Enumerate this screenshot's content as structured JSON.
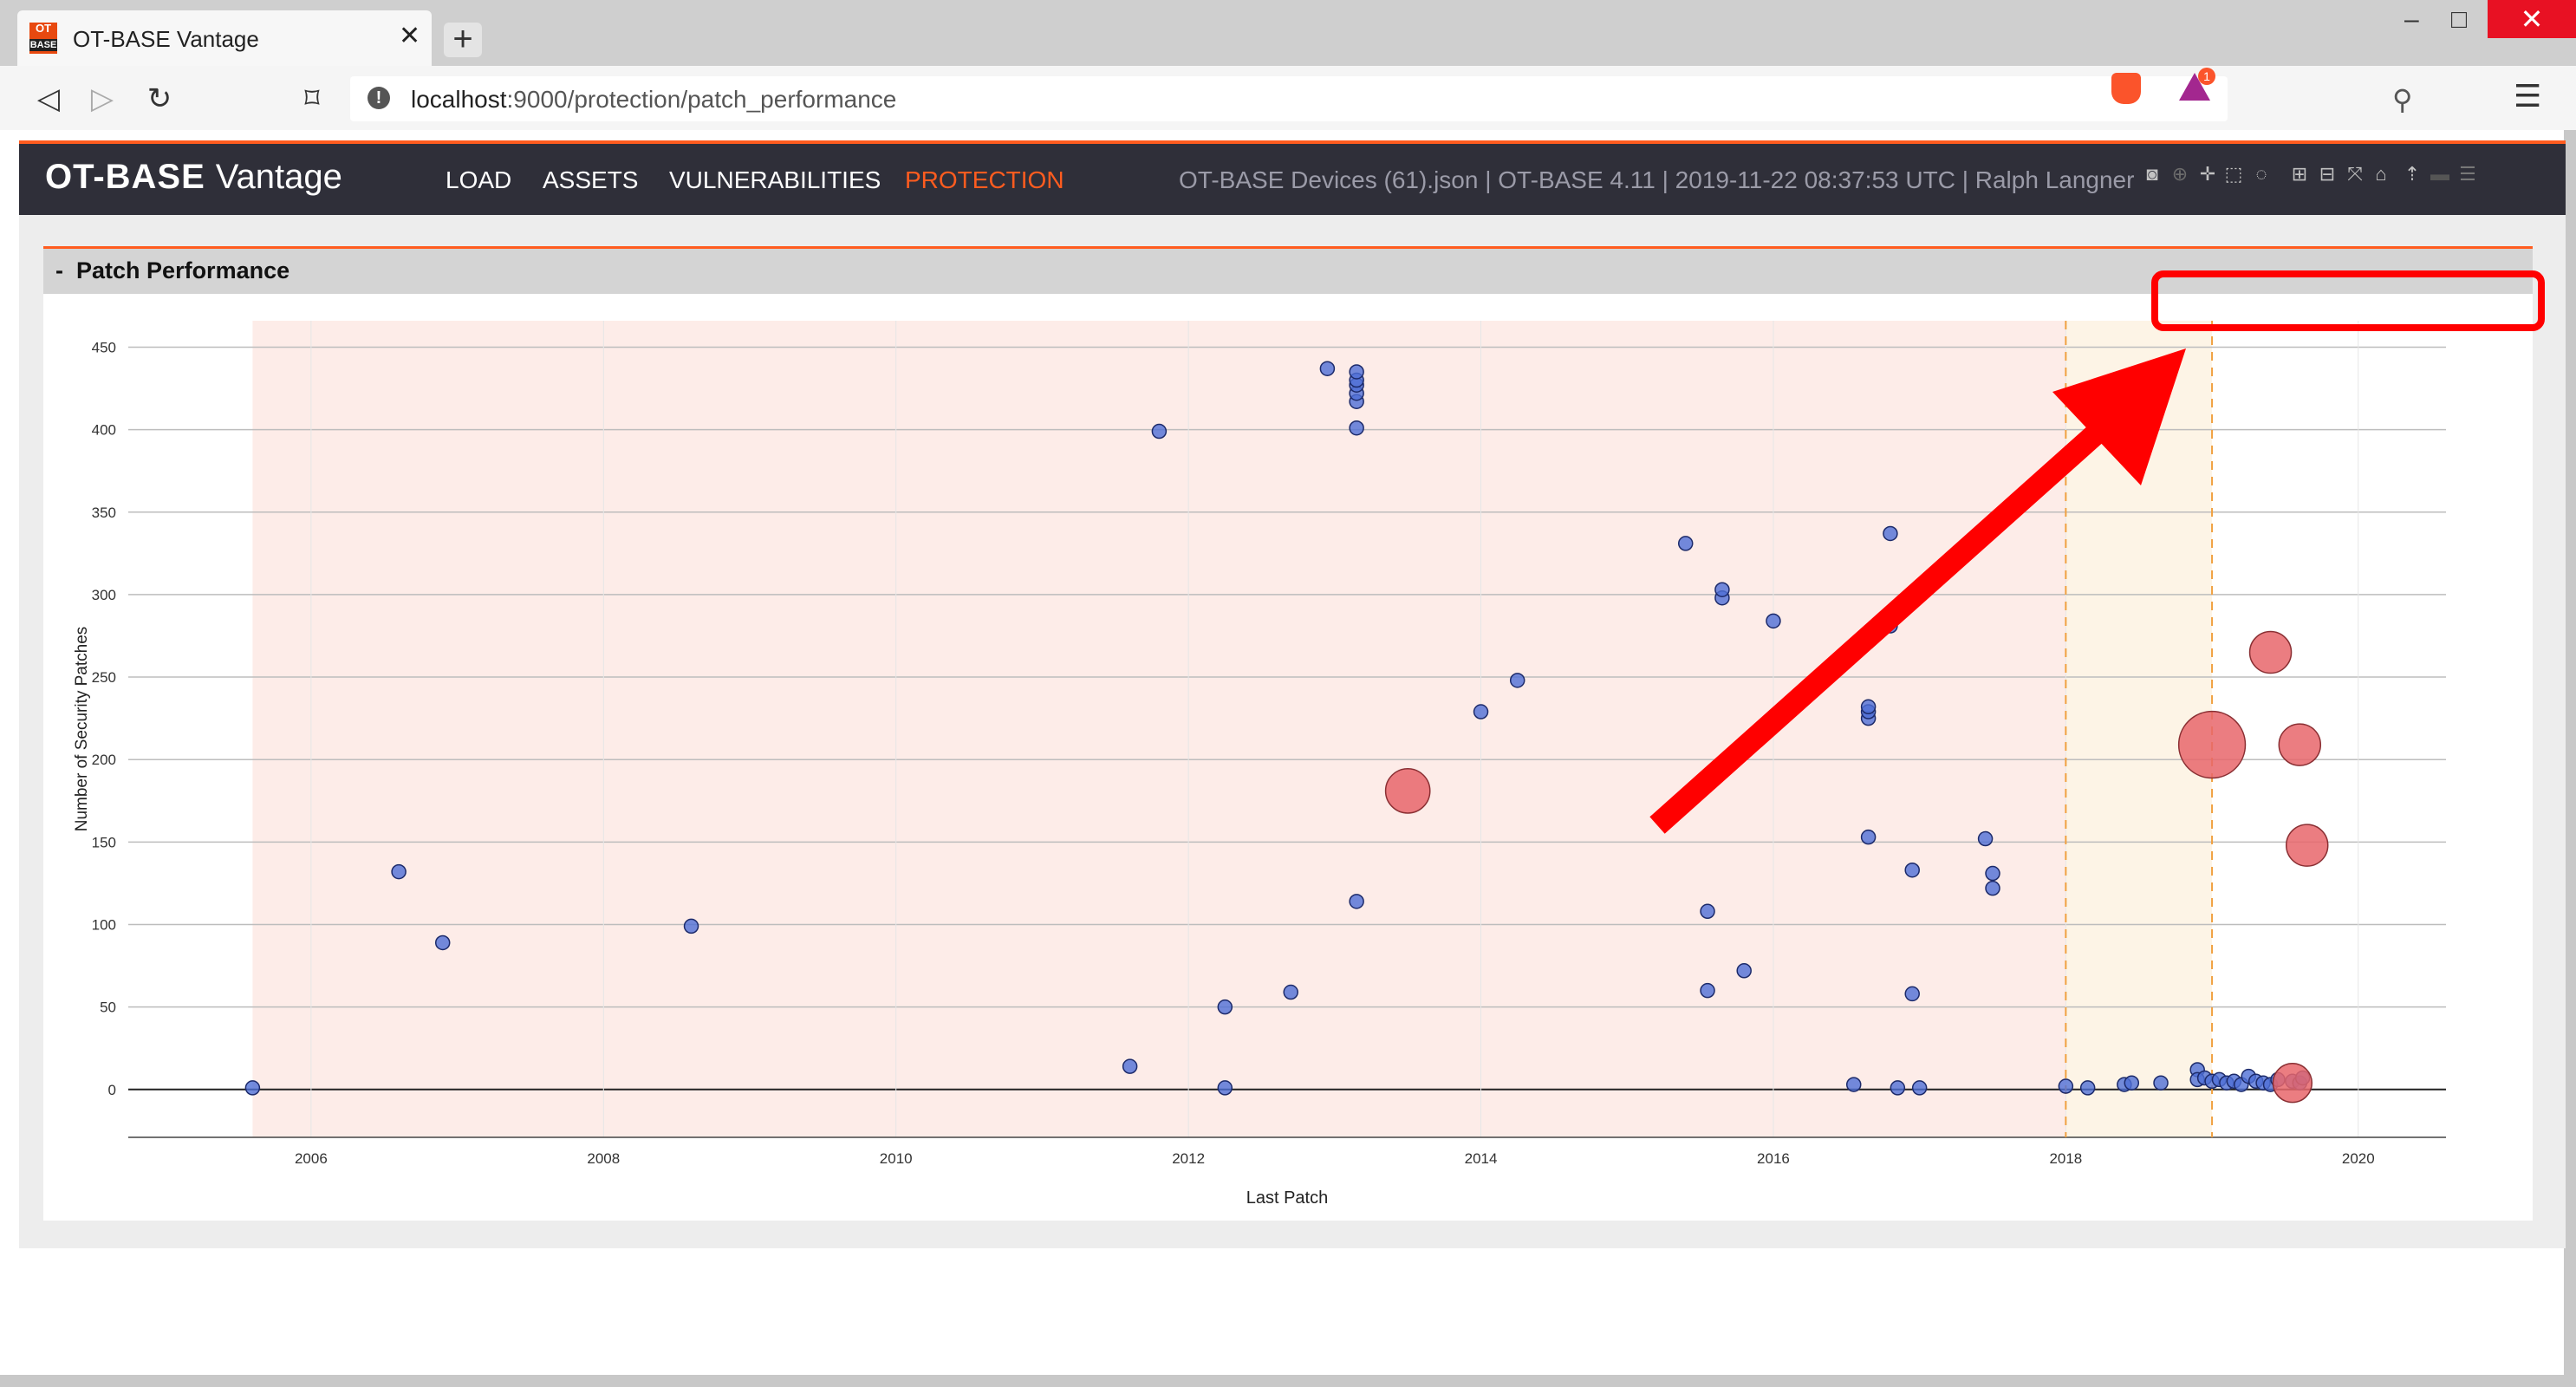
{
  "browser": {
    "tab_title": "OT-BASE Vantage",
    "favicon_top": "OT",
    "favicon_bottom": "BASE",
    "url_host": "localhost",
    "url_rest": ":9000/protection/patch_performance",
    "notification_badge": "1"
  },
  "app": {
    "brand_bold": "OT-BASE",
    "brand_light": "Vantage",
    "nav": [
      {
        "label": "LOAD"
      },
      {
        "label": "ASSETS"
      },
      {
        "label": "VULNERABILITIES"
      },
      {
        "label": "PROTECTION"
      }
    ],
    "active_nav": "PROTECTION",
    "info": "OT-BASE Devices (61).json | OT-BASE 4.11 | 2019-11-22 08:37:53 UTC | Ralph Langner",
    "accent_color": "#ff5c1f",
    "header_bg": "#2f2f39"
  },
  "panel": {
    "collapse_glyph": "-",
    "title": "Patch Performance"
  },
  "modebar_icons": [
    "camera-icon",
    "zoom-icon",
    "pan-icon",
    "box-select-icon",
    "lasso-icon",
    "zoom-in-icon",
    "zoom-out-icon",
    "autoscale-icon",
    "home-icon",
    "spike-lines-icon",
    "hover-closest-icon",
    "hover-compare-icon"
  ],
  "chart_data": {
    "type": "scatter",
    "xlabel": "Last Patch",
    "ylabel": "Number of Security Patches",
    "xlim": [
      2004.75,
      2020.6
    ],
    "ylim": [
      -29,
      466
    ],
    "xticks": [
      2006,
      2008,
      2010,
      2012,
      2014,
      2016,
      2018,
      2020
    ],
    "yticks": [
      0,
      50,
      100,
      150,
      200,
      250,
      300,
      350,
      400,
      450
    ],
    "shaded_regions": [
      {
        "x0": 2005.6,
        "x1": 2018.0,
        "color": "#fdece8"
      },
      {
        "x0": 2018.0,
        "x1": 2019.0,
        "color": "#fdf4e6"
      }
    ],
    "vlines": [
      2018.0,
      2019.0
    ],
    "grid": true,
    "series": [
      {
        "color": "#4f6fd6",
        "points": [
          [
            2005.6,
            1
          ],
          [
            2006.6,
            132
          ],
          [
            2006.9,
            89
          ],
          [
            2008.6,
            99
          ],
          [
            2011.6,
            14
          ],
          [
            2011.8,
            399
          ],
          [
            2012.25,
            50
          ],
          [
            2012.25,
            1
          ],
          [
            2012.7,
            59
          ],
          [
            2012.95,
            437
          ],
          [
            2013.15,
            114
          ],
          [
            2013.15,
            401
          ],
          [
            2013.15,
            417
          ],
          [
            2013.15,
            422
          ],
          [
            2013.15,
            427
          ],
          [
            2013.15,
            430
          ],
          [
            2013.15,
            435
          ],
          [
            2014.0,
            229
          ],
          [
            2014.25,
            248
          ],
          [
            2015.4,
            331
          ],
          [
            2015.55,
            60
          ],
          [
            2015.55,
            108
          ],
          [
            2015.65,
            298
          ],
          [
            2015.65,
            303
          ],
          [
            2015.8,
            72
          ],
          [
            2016.0,
            284
          ],
          [
            2016.55,
            3
          ],
          [
            2016.65,
            153
          ],
          [
            2016.65,
            225
          ],
          [
            2016.65,
            229
          ],
          [
            2016.65,
            232
          ],
          [
            2016.8,
            337
          ],
          [
            2016.8,
            281
          ],
          [
            2016.85,
            1
          ],
          [
            2016.95,
            58
          ],
          [
            2016.95,
            133
          ],
          [
            2017.0,
            1
          ],
          [
            2017.45,
            152
          ],
          [
            2017.5,
            122
          ],
          [
            2017.5,
            131
          ],
          [
            2018.0,
            2
          ],
          [
            2018.15,
            1
          ],
          [
            2018.4,
            3
          ],
          [
            2018.45,
            4
          ],
          [
            2018.65,
            4
          ],
          [
            2018.9,
            12
          ],
          [
            2018.9,
            6
          ],
          [
            2018.95,
            7
          ],
          [
            2019.0,
            5
          ],
          [
            2019.05,
            6
          ],
          [
            2019.1,
            4
          ],
          [
            2019.15,
            5
          ],
          [
            2019.2,
            3
          ],
          [
            2019.25,
            8
          ],
          [
            2019.3,
            5
          ],
          [
            2019.35,
            4
          ],
          [
            2019.4,
            3
          ],
          [
            2019.45,
            6
          ],
          [
            2019.55,
            5
          ],
          [
            2019.6,
            4
          ],
          [
            2019.62,
            7
          ]
        ]
      },
      {
        "color": "#e8666b",
        "points": [
          [
            2013.5,
            181,
            16
          ],
          [
            2019.0,
            209,
            24
          ],
          [
            2019.4,
            265,
            15
          ],
          [
            2019.6,
            209,
            15
          ],
          [
            2019.65,
            148,
            15
          ],
          [
            2019.55,
            4,
            14
          ]
        ]
      }
    ]
  }
}
